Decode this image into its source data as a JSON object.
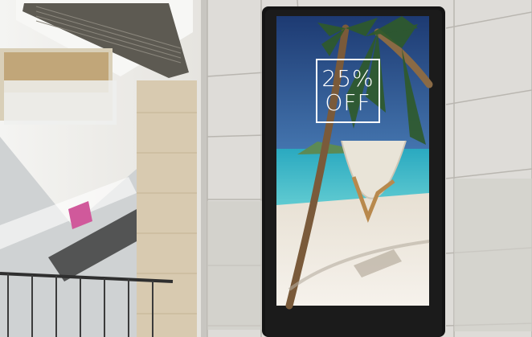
{
  "scene": {
    "description_free": true,
    "sign": {
      "promo_line_1": "25%",
      "promo_line_2": "OFF"
    },
    "colors": {
      "wall": "#dcdad5",
      "panel_frame": "#151515",
      "sky_top": "#1f3f7a",
      "sky_bottom": "#6fa7d4",
      "sea": "#2fb8c6",
      "sand": "#efe8dd",
      "rail": "#3a3a3a"
    }
  }
}
